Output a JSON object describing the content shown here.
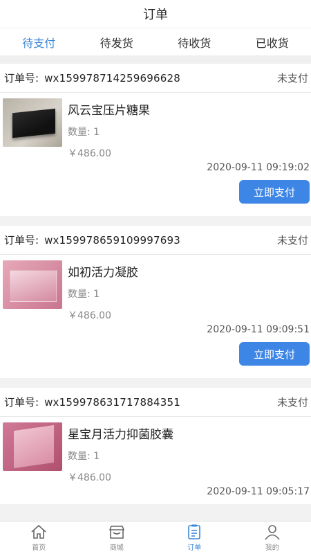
{
  "header": {
    "title": "订单"
  },
  "tabs": [
    {
      "label": "待支付",
      "active": true
    },
    {
      "label": "待发货",
      "active": false
    },
    {
      "label": "待收货",
      "active": false
    },
    {
      "label": "已收货",
      "active": false
    }
  ],
  "orders": [
    {
      "no_label": "订单号:",
      "no": "wx15997871425969662 8",
      "status": "未支付",
      "product": "风云宝压片糖果",
      "qty": "数量: 1",
      "price": "￥486.00",
      "time": "2020-09-11 09:19:02",
      "pay_label": "立即支付"
    },
    {
      "no_label": "订单号:",
      "no": "wx159978659109997693",
      "status": "未支付",
      "product": "如初活力凝胶",
      "qty": "数量: 1",
      "price": "￥486.00",
      "time": "2020-09-11 09:09:51",
      "pay_label": "立即支付"
    },
    {
      "no_label": "订单号:",
      "no": "wx159978631717884351",
      "status": "未支付",
      "product": "星宝月活力抑菌胶囊",
      "qty": "数量: 1",
      "price": "￥486.00",
      "time": "2020-09-11 09:05:17",
      "pay_label": "立即支付"
    }
  ],
  "tabbar": [
    {
      "label": "首页",
      "icon": "home-icon"
    },
    {
      "label": "商城",
      "icon": "shop-icon"
    },
    {
      "label": "订单",
      "icon": "order-icon",
      "active": true
    },
    {
      "label": "我的",
      "icon": "user-icon"
    }
  ],
  "colors": {
    "accent": "#3a86d8",
    "button": "#3e86e6"
  }
}
